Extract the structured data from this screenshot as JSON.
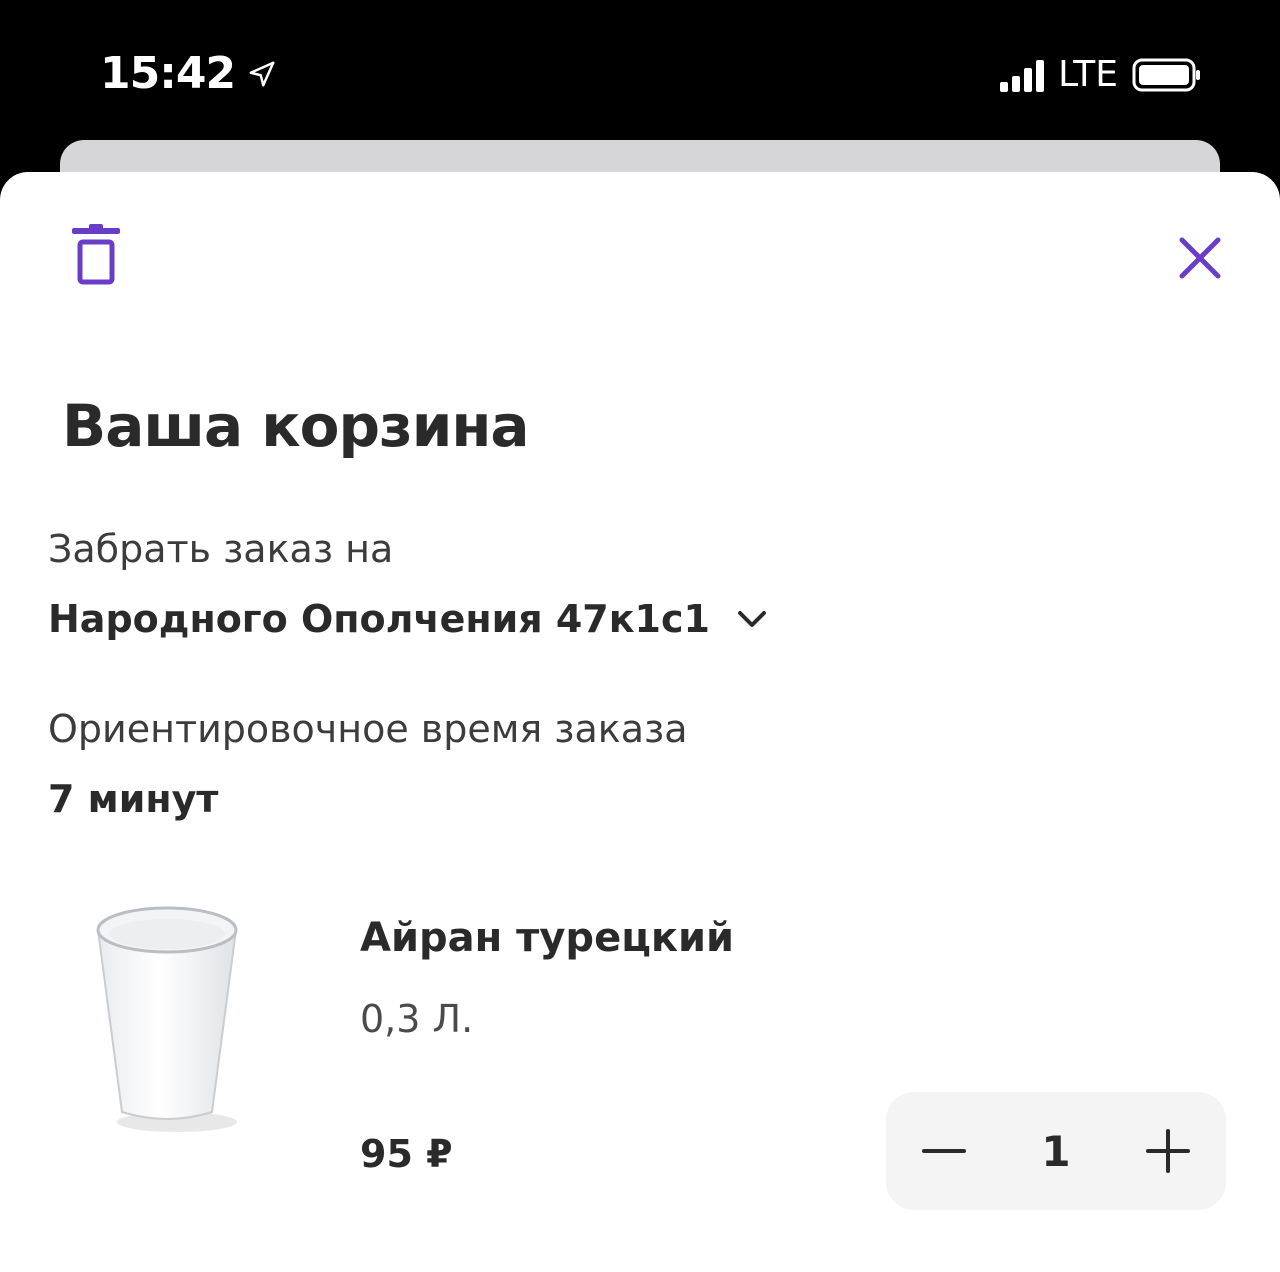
{
  "status_bar": {
    "time": "15:42",
    "network": "LTE"
  },
  "colors": {
    "accent": "#6A3DC8",
    "text_primary": "#2A2A2A",
    "stepper_bg": "#F4F4F5"
  },
  "icons": {
    "delete": "trash-icon",
    "close": "close-icon",
    "address_toggle": "chevron-down-icon",
    "decrease": "minus-icon",
    "increase": "plus-icon"
  },
  "cart": {
    "title": "Ваша корзина",
    "pickup_label": "Забрать заказ на",
    "pickup_address": "Народного Ополчения 47к1с1",
    "eta_label": "Ориентировочное время заказа",
    "eta_value": "7 минут",
    "items": [
      {
        "name": "Айран турецкий",
        "volume": "0,3 Л.",
        "price": "95 ₽",
        "quantity": "1"
      }
    ]
  }
}
